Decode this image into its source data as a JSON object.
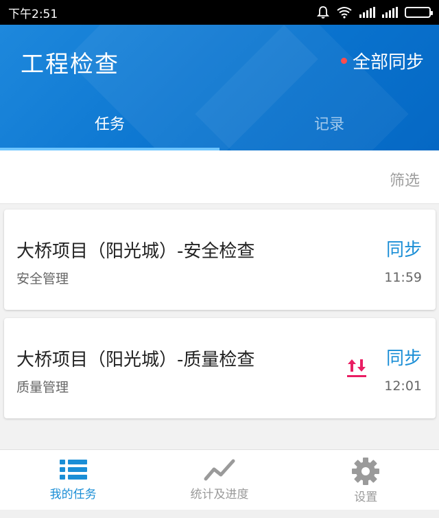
{
  "status_bar": {
    "time": "下午2:51"
  },
  "header": {
    "title": "工程检查",
    "sync_all_label": "全部同步",
    "tabs": [
      {
        "label": "任务",
        "active": true
      },
      {
        "label": "记录",
        "active": false
      }
    ]
  },
  "filter": {
    "label": "筛选"
  },
  "tasks": [
    {
      "title": "大桥项目（阳光城）-安全检查",
      "category": "安全管理",
      "sync_label": "同步",
      "time": "11:59",
      "has_transfer_icon": false
    },
    {
      "title": "大桥项目（阳光城）-质量检查",
      "category": "质量管理",
      "sync_label": "同步",
      "time": "12:01",
      "has_transfer_icon": true
    }
  ],
  "bottom_nav": [
    {
      "label": "我的任务",
      "icon": "list-icon",
      "active": true
    },
    {
      "label": "统计及进度",
      "icon": "chart-line-icon",
      "active": false
    },
    {
      "label": "设置",
      "icon": "gear-icon",
      "active": false
    }
  ],
  "colors": {
    "primary": "#0a74cf",
    "accent_text": "#1a8ed6",
    "notification_dot": "#ff4d4d",
    "transfer_icon": "#e91e63"
  }
}
